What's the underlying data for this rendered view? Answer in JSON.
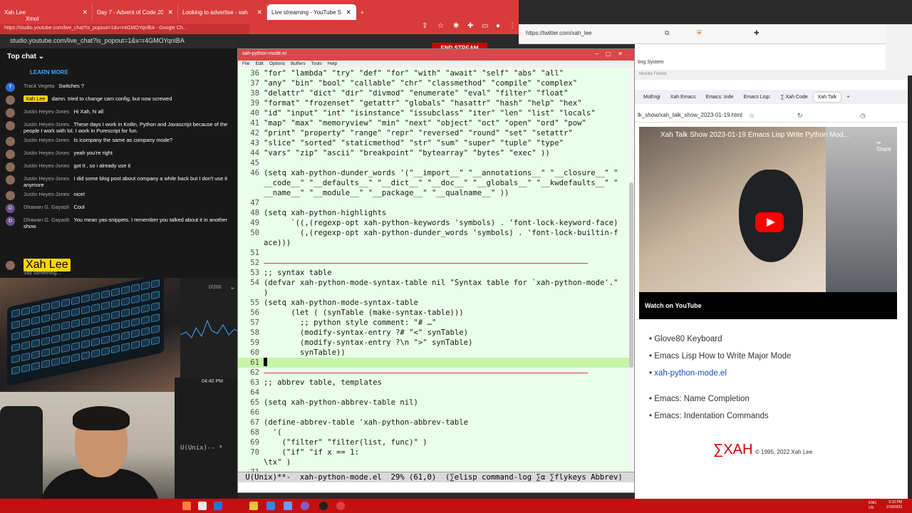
{
  "chrome": {
    "tabs": [
      {
        "label": "Xah Lee",
        "active": false
      },
      {
        "label": "Day 7 - Advent of Code 20",
        "active": false
      },
      {
        "label": "Looking to advertise - xah",
        "active": false
      },
      {
        "label": "Live streaming - YouTube S",
        "active": true
      }
    ],
    "new_tab": "+",
    "partial_label": "Xmol",
    "address": "studio.youtube.com/live_chat?is_popout=1&v=r4GMOYqnlBA"
  },
  "popout": {
    "bar_text": "https://studio.youtube.com/live_chat?is_popout=1&v=r4GMOYqnlBA - Google Ch...",
    "address": "studio.youtube.com/live_chat?is_popout=1&v=r4GMOYqnlBA"
  },
  "end_stream": "END STREAM",
  "chat": {
    "header": "Top chat",
    "learn_more": "LEARN MORE",
    "messages": [
      {
        "author": "Track Vegeta",
        "text": "Switches ?",
        "owner": false,
        "initial": "T"
      },
      {
        "author": "Xah Lee",
        "text": "damn. tried to change cam config, but now screwed",
        "owner": true,
        "initial": ""
      },
      {
        "author": "Justin Heyes-Jones",
        "text": "Hi Xah, hi all",
        "owner": false,
        "initial": ""
      },
      {
        "author": "Justin Heyes-Jones",
        "text": "These days I work in Kotlin, Python and Javascript because of the people I work with lol. I work in Purescript for fun.",
        "owner": false,
        "initial": ""
      },
      {
        "author": "Justin Heyes-Jones",
        "text": "Is icompany the same as company mode?",
        "owner": false,
        "initial": ""
      },
      {
        "author": "Justin Heyes-Jones",
        "text": "yeah you're right",
        "owner": false,
        "initial": ""
      },
      {
        "author": "Justin Heyes-Jones",
        "text": "got it , so i already use it",
        "owner": false,
        "initial": ""
      },
      {
        "author": "Justin Heyes-Jones",
        "text": "I did some blog post about company a while back but I don't use it anymore",
        "owner": false,
        "initial": ""
      },
      {
        "author": "Justin Heyes-Jones",
        "text": "nice!",
        "owner": false,
        "initial": ""
      },
      {
        "author": "Dhawan G. Gayash",
        "text": "Cool",
        "owner": false,
        "initial": "D"
      },
      {
        "author": "Dhawan G. Gayash",
        "text": "You mean yas-snippets. I remember you talked about it in another show.",
        "owner": false,
        "initial": "D"
      }
    ],
    "input_author": "Xah Lee",
    "input_placeholder": "Say something...",
    "char_count": "0/200",
    "time": "04:40 PM"
  },
  "emacs": {
    "title": "xah-python-mode.el",
    "menu": [
      "File",
      "Edit",
      "Options",
      "Buffers",
      "Tools",
      "Help"
    ],
    "lines": [
      {
        "n": "36",
        "t": "\"for\" \"lambda\" \"try\" \"def\" \"for\" \"with\" \"await\" \"self\" \"abs\" \"all\""
      },
      {
        "n": "37",
        "t": "\"any\" \"bin\" \"bool\" \"callable\" \"chr\" \"classmethod\" \"compile\" \"complex\""
      },
      {
        "n": "38",
        "t": "\"delattr\" \"dict\" \"dir\" \"divmod\" \"enumerate\" \"eval\" \"filter\" \"float\""
      },
      {
        "n": "39",
        "t": "\"format\" \"frozenset\" \"getattr\" \"globals\" \"hasattr\" \"hash\" \"help\" \"hex\""
      },
      {
        "n": "40",
        "t": "\"id\" \"input\" \"int\" \"isinstance\" \"issubclass\" \"iter\" \"len\" \"list\" \"locals\""
      },
      {
        "n": "41",
        "t": "\"map\" \"max\" \"memoryview\" \"min\" \"next\" \"object\" \"oct\" \"open\" \"ord\" \"pow\""
      },
      {
        "n": "42",
        "t": "\"print\" \"property\" \"range\" \"repr\" \"reversed\" \"round\" \"set\" \"setattr\""
      },
      {
        "n": "43",
        "t": "\"slice\" \"sorted\" \"staticmethod\" \"str\" \"sum\" \"super\" \"tuple\" \"type\""
      },
      {
        "n": "44",
        "t": "\"vars\" \"zip\" \"ascii\" \"breakpoint\" \"bytearray\" \"bytes\" \"exec\" ))"
      },
      {
        "n": "45",
        "t": ""
      },
      {
        "n": "46",
        "t": "(setq xah-python-dunder_words '(\"__import__\" \"__annotations__\" \"__closure__\" \""
      },
      {
        "n": "",
        "t": "__code__\" \"__defaults__\" \"__dict__\" \"__doc__\" \"__globals__\" \"__kwdefaults__\" \""
      },
      {
        "n": "",
        "t": "__name__\" \"__module__\" \"__package__\" \"__qualname__\" ))"
      },
      {
        "n": "47",
        "t": ""
      },
      {
        "n": "48",
        "t": "(setq xah-python-highlights"
      },
      {
        "n": "49",
        "t": "      `((,(regexp-opt xah-python-keywords 'symbols) . 'font-lock-keyword-face)"
      },
      {
        "n": "50",
        "t": "        (,(regexp-opt xah-python-dunder_words 'symbols) . 'font-lock-builtin-f"
      },
      {
        "n": "",
        "t": "ace)))"
      },
      {
        "n": "51",
        "t": ""
      },
      {
        "n": "52",
        "t": "",
        "rule": true
      },
      {
        "n": "53",
        "t": ";; syntax table"
      },
      {
        "n": "54",
        "t": "(defvar xah-python-mode-syntax-table nil \"Syntax table for `xah-python-mode'.\""
      },
      {
        "n": "",
        "t": ")"
      },
      {
        "n": "55",
        "t": "(setq xah-python-mode-syntax-table"
      },
      {
        "n": "56",
        "t": "      (let ( (synTable (make-syntax-table)))"
      },
      {
        "n": "57",
        "t": "        ;; python style comment: \"# …\""
      },
      {
        "n": "58",
        "t": "        (modify-syntax-entry ?# \"<\" synTable)"
      },
      {
        "n": "59",
        "t": "        (modify-syntax-entry ?\\n \">\" synTable)"
      },
      {
        "n": "60",
        "t": "        synTable))"
      },
      {
        "n": "61",
        "t": "",
        "cursor": true
      },
      {
        "n": "62",
        "t": "",
        "rule": true
      },
      {
        "n": "63",
        "t": ";; abbrev table, templates"
      },
      {
        "n": "64",
        "t": ""
      },
      {
        "n": "65",
        "t": "(setq xah-python-abbrev-table nil)"
      },
      {
        "n": "66",
        "t": ""
      },
      {
        "n": "67",
        "t": "(define-abbrev-table 'xah-python-abbrev-table"
      },
      {
        "n": "68",
        "t": "  '("
      },
      {
        "n": "69",
        "t": "    (\"filter\" \"filter(list, func)\" )"
      },
      {
        "n": "70",
        "t": "    (\"if\" \"if x == 1:"
      },
      {
        "n": "",
        "t": "\\tx\" )"
      },
      {
        "n": "71",
        "t": ""
      }
    ],
    "modeline": " U(Unix)**-  xah-python-mode.el  29% (61,0)  (∑elisp command-log ∑α ∑flykeys Abbrev)",
    "left_modeline": "U(Unix)-- *"
  },
  "twitter": {
    "address": "https://twitter.com/xah_lee",
    "partial": "ting System"
  },
  "firefox": {
    "title": "Mozilla Firefox",
    "tabs": [
      "MoEngi",
      "Xah Emacs",
      "Emacs: Inde",
      "Emacs Lisp:",
      "∑ Xah Code",
      "Xah Talk"
    ],
    "address": "lk_show/xah_talk_show_2023-01-19.html",
    "video_title": "Xah Talk Show 2023-01-19 Emacs Lisp Write Python Mod...",
    "share": "Share",
    "watch_on": "Watch on",
    "youtube": "YouTube",
    "links": [
      {
        "label": "Glove80 Keyboard",
        "blue": false
      },
      {
        "label": "Emacs Lisp How to Write Major Mode",
        "blue": false
      },
      {
        "label": "xah-python-mode.el",
        "blue": true
      },
      {
        "label": "Emacs: Name Completion",
        "blue": false
      },
      {
        "label": "Emacs: Indentation Commands",
        "blue": false
      }
    ],
    "logo": "∑XAH",
    "copyright": "© 1995, 2022 Xah Lee."
  },
  "taskbar": {
    "lang": "ENG\nUS",
    "time": "5:10 PM",
    "date": "1/19/2023"
  }
}
